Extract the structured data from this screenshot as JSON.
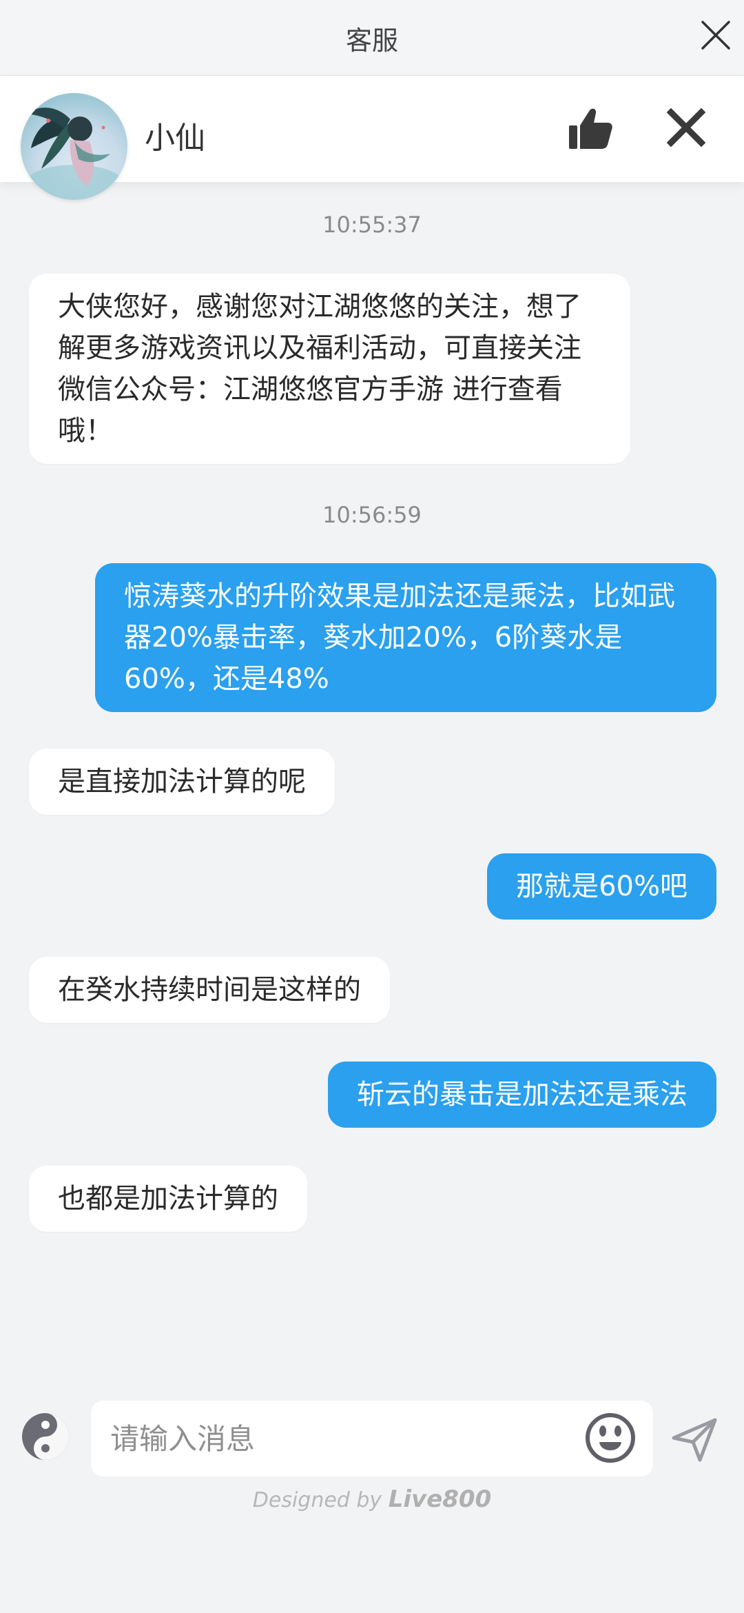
{
  "header": {
    "title": "客服"
  },
  "agent": {
    "name": "小仙"
  },
  "messages": [
    {
      "type": "timestamp",
      "text": "10:55:37"
    },
    {
      "type": "incoming",
      "text": "大侠您好，感谢您对江湖悠悠的关注，想了解更多游戏资讯以及福利活动，可直接关注微信公众号：江湖悠悠官方手游 进行查看哦！"
    },
    {
      "type": "timestamp",
      "text": "10:56:59"
    },
    {
      "type": "outgoing",
      "text": "惊涛葵水的升阶效果是加法还是乘法，比如武器20%暴击率，葵水加20%，6阶葵水是60%，还是48%"
    },
    {
      "type": "incoming",
      "text": "是直接加法计算的呢"
    },
    {
      "type": "outgoing",
      "text": "那就是60%吧"
    },
    {
      "type": "incoming",
      "text": "在癸水持续时间是这样的"
    },
    {
      "type": "outgoing",
      "text": "斩云的暴击是加法还是乘法"
    },
    {
      "type": "incoming",
      "text": "也都是加法计算的"
    }
  ],
  "composer": {
    "placeholder": "请输入消息"
  },
  "footer": {
    "prefix": "Designed by ",
    "brand": "Live800"
  },
  "colors": {
    "accent": "#2aa0ee",
    "background": "#f2f3f5",
    "incoming_bubble": "#ffffff"
  },
  "icons": {
    "header_close": "close-icon",
    "thumb": "thumbs-up-icon",
    "agent_close": "close-icon",
    "logo": "live800-logo-icon",
    "emoji": "emoji-icon",
    "send": "send-icon"
  }
}
